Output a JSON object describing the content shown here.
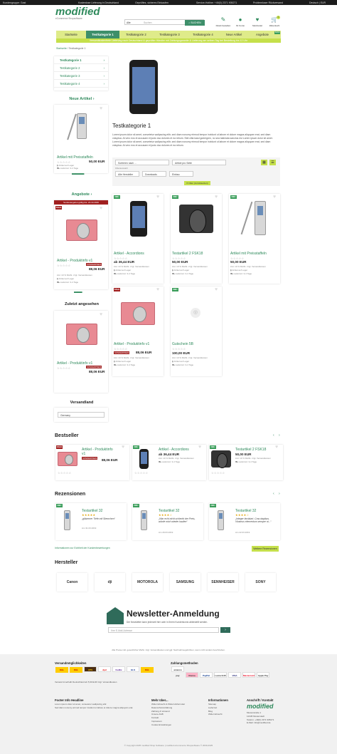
{
  "topbar": {
    "left": "Kundengruppe: Gast",
    "features": [
      "Kostenlose Lieferung in Deutschland",
      "Geprüftes, sicheres Einkaufen",
      "Service-Hotline: +49(0) 2371 905271",
      "Problemloser Rückversand"
    ],
    "lang": "Deutsch | EUR"
  },
  "header": {
    "logo": "modified",
    "tagline": "eCommerce Shopsoftware",
    "search_category": "Alle",
    "search_placeholder": "Suchen",
    "search_button": "SUCHEN",
    "icons": [
      "Direkt bestellen",
      "Ihr Konto",
      "Merkzettel",
      "Warenkorb"
    ],
    "cart_count": "0"
  },
  "nav": {
    "items": [
      "Startseite",
      "Testkategorie 1",
      "Testkategorie 2",
      "Testkategorie 3",
      "Testkategorie 4",
      "Neue Artikel",
      "Angebote"
    ]
  },
  "promo": "Versandkostenfreie Lieferung nach Deutschland & geprüfter Händler mit Zahlungsgarantie & Lieferung am selben Tag bei Bestellung bis 12 Uhr",
  "breadcrumb": [
    "Startseite",
    "Testkategorie 1"
  ],
  "sidebar": {
    "categories": [
      "Testkategorie 1",
      "Testkategorie 2",
      "Testkategorie 3",
      "Testkategorie 4"
    ],
    "new_title": "Neue Artikel",
    "new_product": {
      "name": "Artikel mit Preisstaffeln",
      "price": "50,00 EUR",
      "stock": "Artikel auf Lager",
      "delivery": "Lieferzeit: 3-4 Tage"
    },
    "offers_title": "Angebote",
    "offer_banner": "Sonderangebot gültig bis: 23.10.2026",
    "offer_product": {
      "name": "Artikel - Produktinfo v1",
      "badge": "SONDERPREIS",
      "price": "88,06 EUR",
      "vat": "inkl. 19 % MwSt. zzgl. Versandkosten",
      "stock": "Artikel auf Lager",
      "delivery": "Lieferzeit: 3-4 Tage"
    },
    "recent_title": "Zuletzt angesehen",
    "recent_product": {
      "name": "Artikel - Produktinfo v1",
      "badge": "SONDERPREIS",
      "price": "88,06 EUR"
    },
    "shipping_title": "Versandland",
    "shipping_country": "Germany"
  },
  "category": {
    "title": "Testkategorie 1",
    "description": "Lorem ipsum dolor sit amet, consetetur sadipscing elitr, sed diam nonumy eirmod tempor invidunt ut labore et dolore magna aliquyam erat, sed diam voluptua. At vero eos et accusam et justo duo dolores et ea rebum. Stet clita kasd gubergren, no sea takimata sanctus est Lorem ipsum dolor sit amet. Lorem ipsum dolor sit amet, consetetur sadipscing elitr, sed diam nonumy eirmod tempor invidunt ut labore et dolore magna aliquyam erat, sed diam voluptua. At vero eos et accusam et justo duo dolores et ea rebum."
  },
  "filters": {
    "sort": "Sortieren nach ...",
    "per_page": "Artikel pro Seite",
    "label": "Filterauswahl",
    "f1": "Alle Hersteller",
    "f2": "Downloads",
    "f3": "Einbau",
    "button": "Filter (zurücksetzen)"
  },
  "products": [
    {
      "name": "Artikel - Accordions",
      "badge": "NEU",
      "price": "36,44 EUR",
      "vat": "inkl. 19 % MwSt. zzgl. Versandkosten",
      "stock": "Artikel auf Lager",
      "delivery": "Lieferzeit: 3-4 Tage"
    },
    {
      "name": "Testartikel 2 FSK18",
      "badge": "NEU",
      "price": "50,00 EUR",
      "vat": "inkl. 19 % MwSt. zzgl. Versandkosten",
      "stock": "Artikel auf Lager",
      "delivery": "Lieferzeit: 3-4 Tage"
    },
    {
      "name": "Artikel mit Preisstaffeln",
      "badge": "NEU",
      "price": "50,00 EUR",
      "vat": "inkl. 19 % MwSt. zzgl. Versandkosten",
      "stock": "Artikel auf Lager",
      "delivery": "Lieferzeit: 3-4 Tage"
    },
    {
      "name": "Artikel - Produktinfo v1",
      "badge": "SALE",
      "price": "88,06 EUR",
      "special": "SONDERPREIS",
      "vat": "inkl. 19 % MwSt. zzgl. Versandkosten",
      "stock": "Artikel auf Lager",
      "delivery": "Lieferzeit: 3-4 Tage"
    },
    {
      "name": "Gutschein 5B",
      "badge": "NEU",
      "price": "100,00 EUR",
      "vat": "inkl. 19 % MwSt. zzgl. Versandkosten",
      "stock": "Artikel auf Lager",
      "delivery": "Lieferzeit: 3-4 Tage"
    }
  ],
  "bestseller": {
    "title": "Bestseller",
    "items": [
      {
        "name": "Artikel - Produktinfo v1",
        "special": "SONDERPREIS",
        "price": "88,06 EUR"
      },
      {
        "name": "Artikel - Accordions",
        "price": "36,44 EUR",
        "vat": "inkl. 19 % MwSt. zzgl. Versandkosten",
        "delivery": "Lieferzeit: 3-4 Tage"
      },
      {
        "name": "Testartikel 2 FSK18",
        "price": "50,00 EUR",
        "vat": "inkl. 19 % MwSt. zzgl. Versandkosten",
        "delivery": "Lieferzeit: 3-4 Tage"
      }
    ]
  },
  "reviews": {
    "title": "Rezensionen",
    "items": [
      {
        "name": "Testartikel 32",
        "text": "„gläserner Tiefe mit Sternchen“",
        "date": "Am 31.03.2019"
      },
      {
        "name": "Testartikel 32",
        "text": "„War echt nicht schlecht der Preis, würde mich wieder kaufen“",
        "date": "Am 29.03.2019"
      },
      {
        "name": "Testartikel 32",
        "text": "„Integer tincidunt. Cras dapibus. Vivamus elementum semper ni...“",
        "date": "Am 22.03.2019"
      }
    ],
    "info": "Informationen zur Echtheit der Kundenbewertungen",
    "button": "Weitere Rezensionen"
  },
  "brands": {
    "title": "Hersteller",
    "items": [
      "Canon",
      "dji",
      "MOTOROLA",
      "SAMSUNG",
      "SENNHEISER",
      "SONY"
    ]
  },
  "newsletter": {
    "title": "Newsletter-Anmeldung",
    "text": "Der Newsletter kann jederzeit hier oder in Ihrem Kundenkonto abbestellt werden.",
    "placeholder": "Ihre E-Mail-Adresse"
  },
  "vat_note": "Alle Preise inkl. gesetzlicher MwSt. zzgl. Versandkosten und ggf. Nachnahmegebühren, wenn nicht anders beschrieben.",
  "footer": {
    "shipping_title": "Versandmöglichkeiten",
    "carriers": [
      "DHL",
      "DHL",
      "UPS",
      "dpd",
      "FedEx",
      "GLS",
      "DHL"
    ],
    "payment_title": "Zahlungsmethoden",
    "payments": [
      "amazon pay",
      "Klarna",
      "PayPal",
      "Lastschrift",
      "VISA",
      "Mastercard",
      "Apple Pay"
    ],
    "shipping_note": "Versand innerhalb Deutschland ab 5,90 EUR zzgl. Versandkosten",
    "cols": [
      {
        "title": "Footer Info Headline",
        "lines": [
          "Lorem ipsum dolor sit amet, consetetur sadipscing elitr.",
          "Sed diam nonumy eirmod tempor invidunt ut labore et dolore magna aliquyam erat."
        ]
      },
      {
        "title": "Mehr über...",
        "lines": [
          "Widerrufsrecht & Widerrufsformular",
          "Datenschutzerklärung",
          "Zahlung & Versand",
          "Unsere AGB",
          "Kontakt",
          "Impressum",
          "Cookie Einstellungen"
        ]
      },
      {
        "title": "Informationen",
        "lines": [
          "Sitemap",
          "Lieferzeit",
          "Blog",
          "Widerrufsrecht"
        ]
      },
      {
        "title": "Anschrift / Kontakt",
        "lines": [
          "modified",
          "Musterstraße 1",
          "12345 Musterstadt",
          "Telefon: +49(0) 2371 905271",
          "E-Mail: info@modified.de"
        ]
      }
    ],
    "copyright": "© Copyright 2025 modified Shop Software | modified eCommerce Shopsoftware © 2009-2025"
  }
}
